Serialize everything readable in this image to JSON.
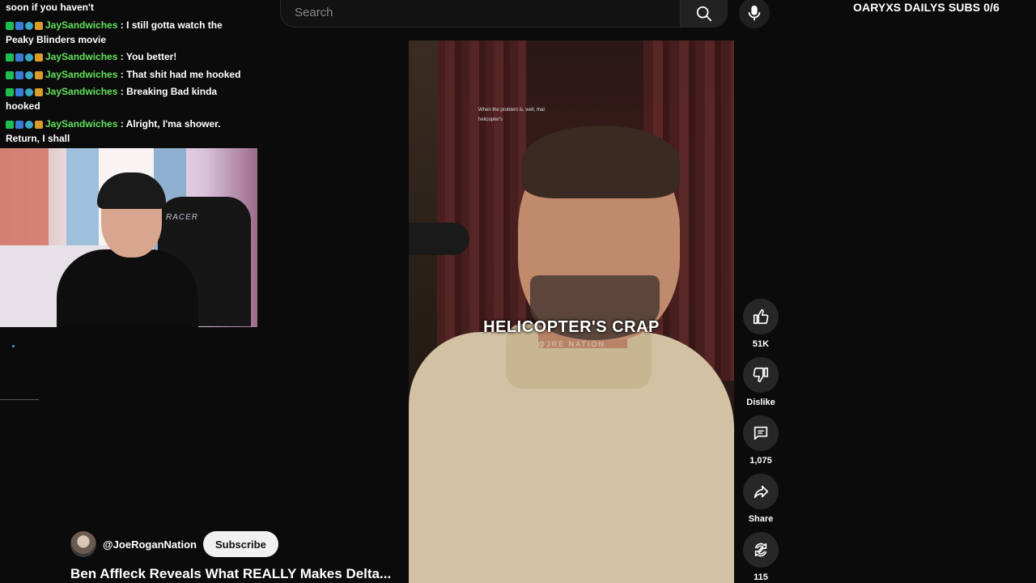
{
  "chat": {
    "top_fragment": "soon if you haven't",
    "messages": [
      {
        "user": "JaySandwiches",
        "text": ": I still gotta watch the",
        "cont": "Peaky Blinders movie"
      },
      {
        "user": "JaySandwiches",
        "text": ": You better!",
        "cont": ""
      },
      {
        "user": "JaySandwiches",
        "text": ": That shit had me hooked",
        "cont": ""
      },
      {
        "user": "JaySandwiches",
        "text": ": Breaking Bad kinda",
        "cont": "hooked"
      },
      {
        "user": "JaySandwiches",
        "text": ": Alright, I'ma shower.",
        "cont": "Return, I shall"
      }
    ],
    "badge_colors": [
      "#1fbf4f",
      "#3b7bd8",
      "#39a8c9",
      "#d99c2b"
    ],
    "username_color": "#63e15d"
  },
  "webcam": {
    "chair_brand": "RACER"
  },
  "search": {
    "placeholder": "Search",
    "search_icon": "search-icon",
    "mic_icon": "microphone-icon"
  },
  "overlay": {
    "subs_goal": "OARYXS DAILYS SUBS 0/6"
  },
  "video": {
    "small_subtitle": "When the problem is, well, that helicopter's",
    "caption": "HELICOPTER'S CRAP",
    "watermark": "@JRE NATION"
  },
  "actions": {
    "like_count": "51K",
    "dislike_label": "Dislike",
    "comment_count": "1,075",
    "share_label": "Share",
    "remix_count": "115"
  },
  "channel": {
    "handle": "@JoeRoganNation",
    "subscribe_label": "Subscribe"
  },
  "title": "Ben Affleck Reveals What REALLY Makes Delta..."
}
